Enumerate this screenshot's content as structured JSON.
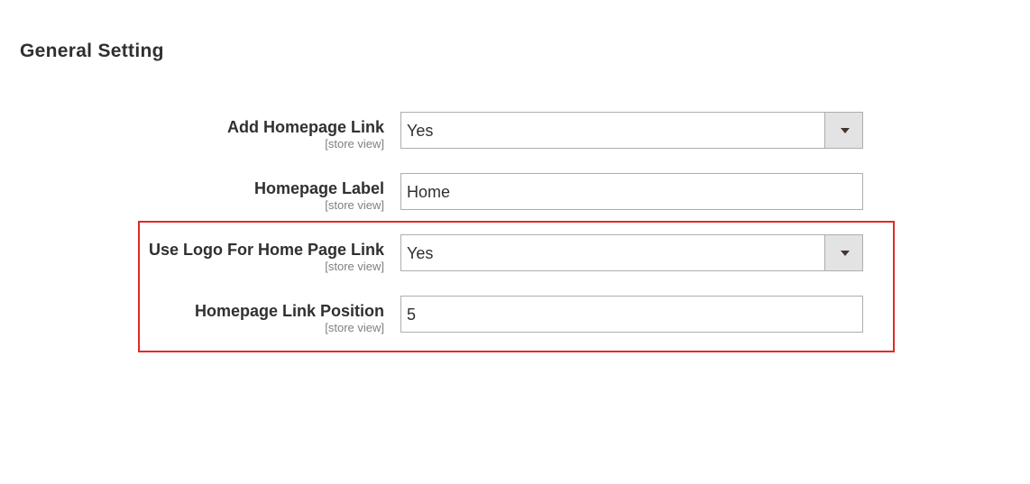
{
  "section": {
    "title": "General Setting"
  },
  "fields": [
    {
      "label": "Add Homepage Link",
      "scope": "[store view]",
      "type": "select",
      "value": "Yes"
    },
    {
      "label": "Homepage Label",
      "scope": "[store view]",
      "type": "text",
      "value": "Home"
    },
    {
      "label": "Use Logo For Home Page Link",
      "scope": "[store view]",
      "type": "select",
      "value": "Yes"
    },
    {
      "label": "Homepage Link Position",
      "scope": "[store view]",
      "type": "text",
      "value": "5"
    }
  ],
  "highlight": {
    "color": "#e02b27",
    "covers_fields": [
      "Use Logo For Home Page Link",
      "Homepage Link Position"
    ]
  },
  "icons": {
    "select_arrow": "chevron-down-icon"
  }
}
